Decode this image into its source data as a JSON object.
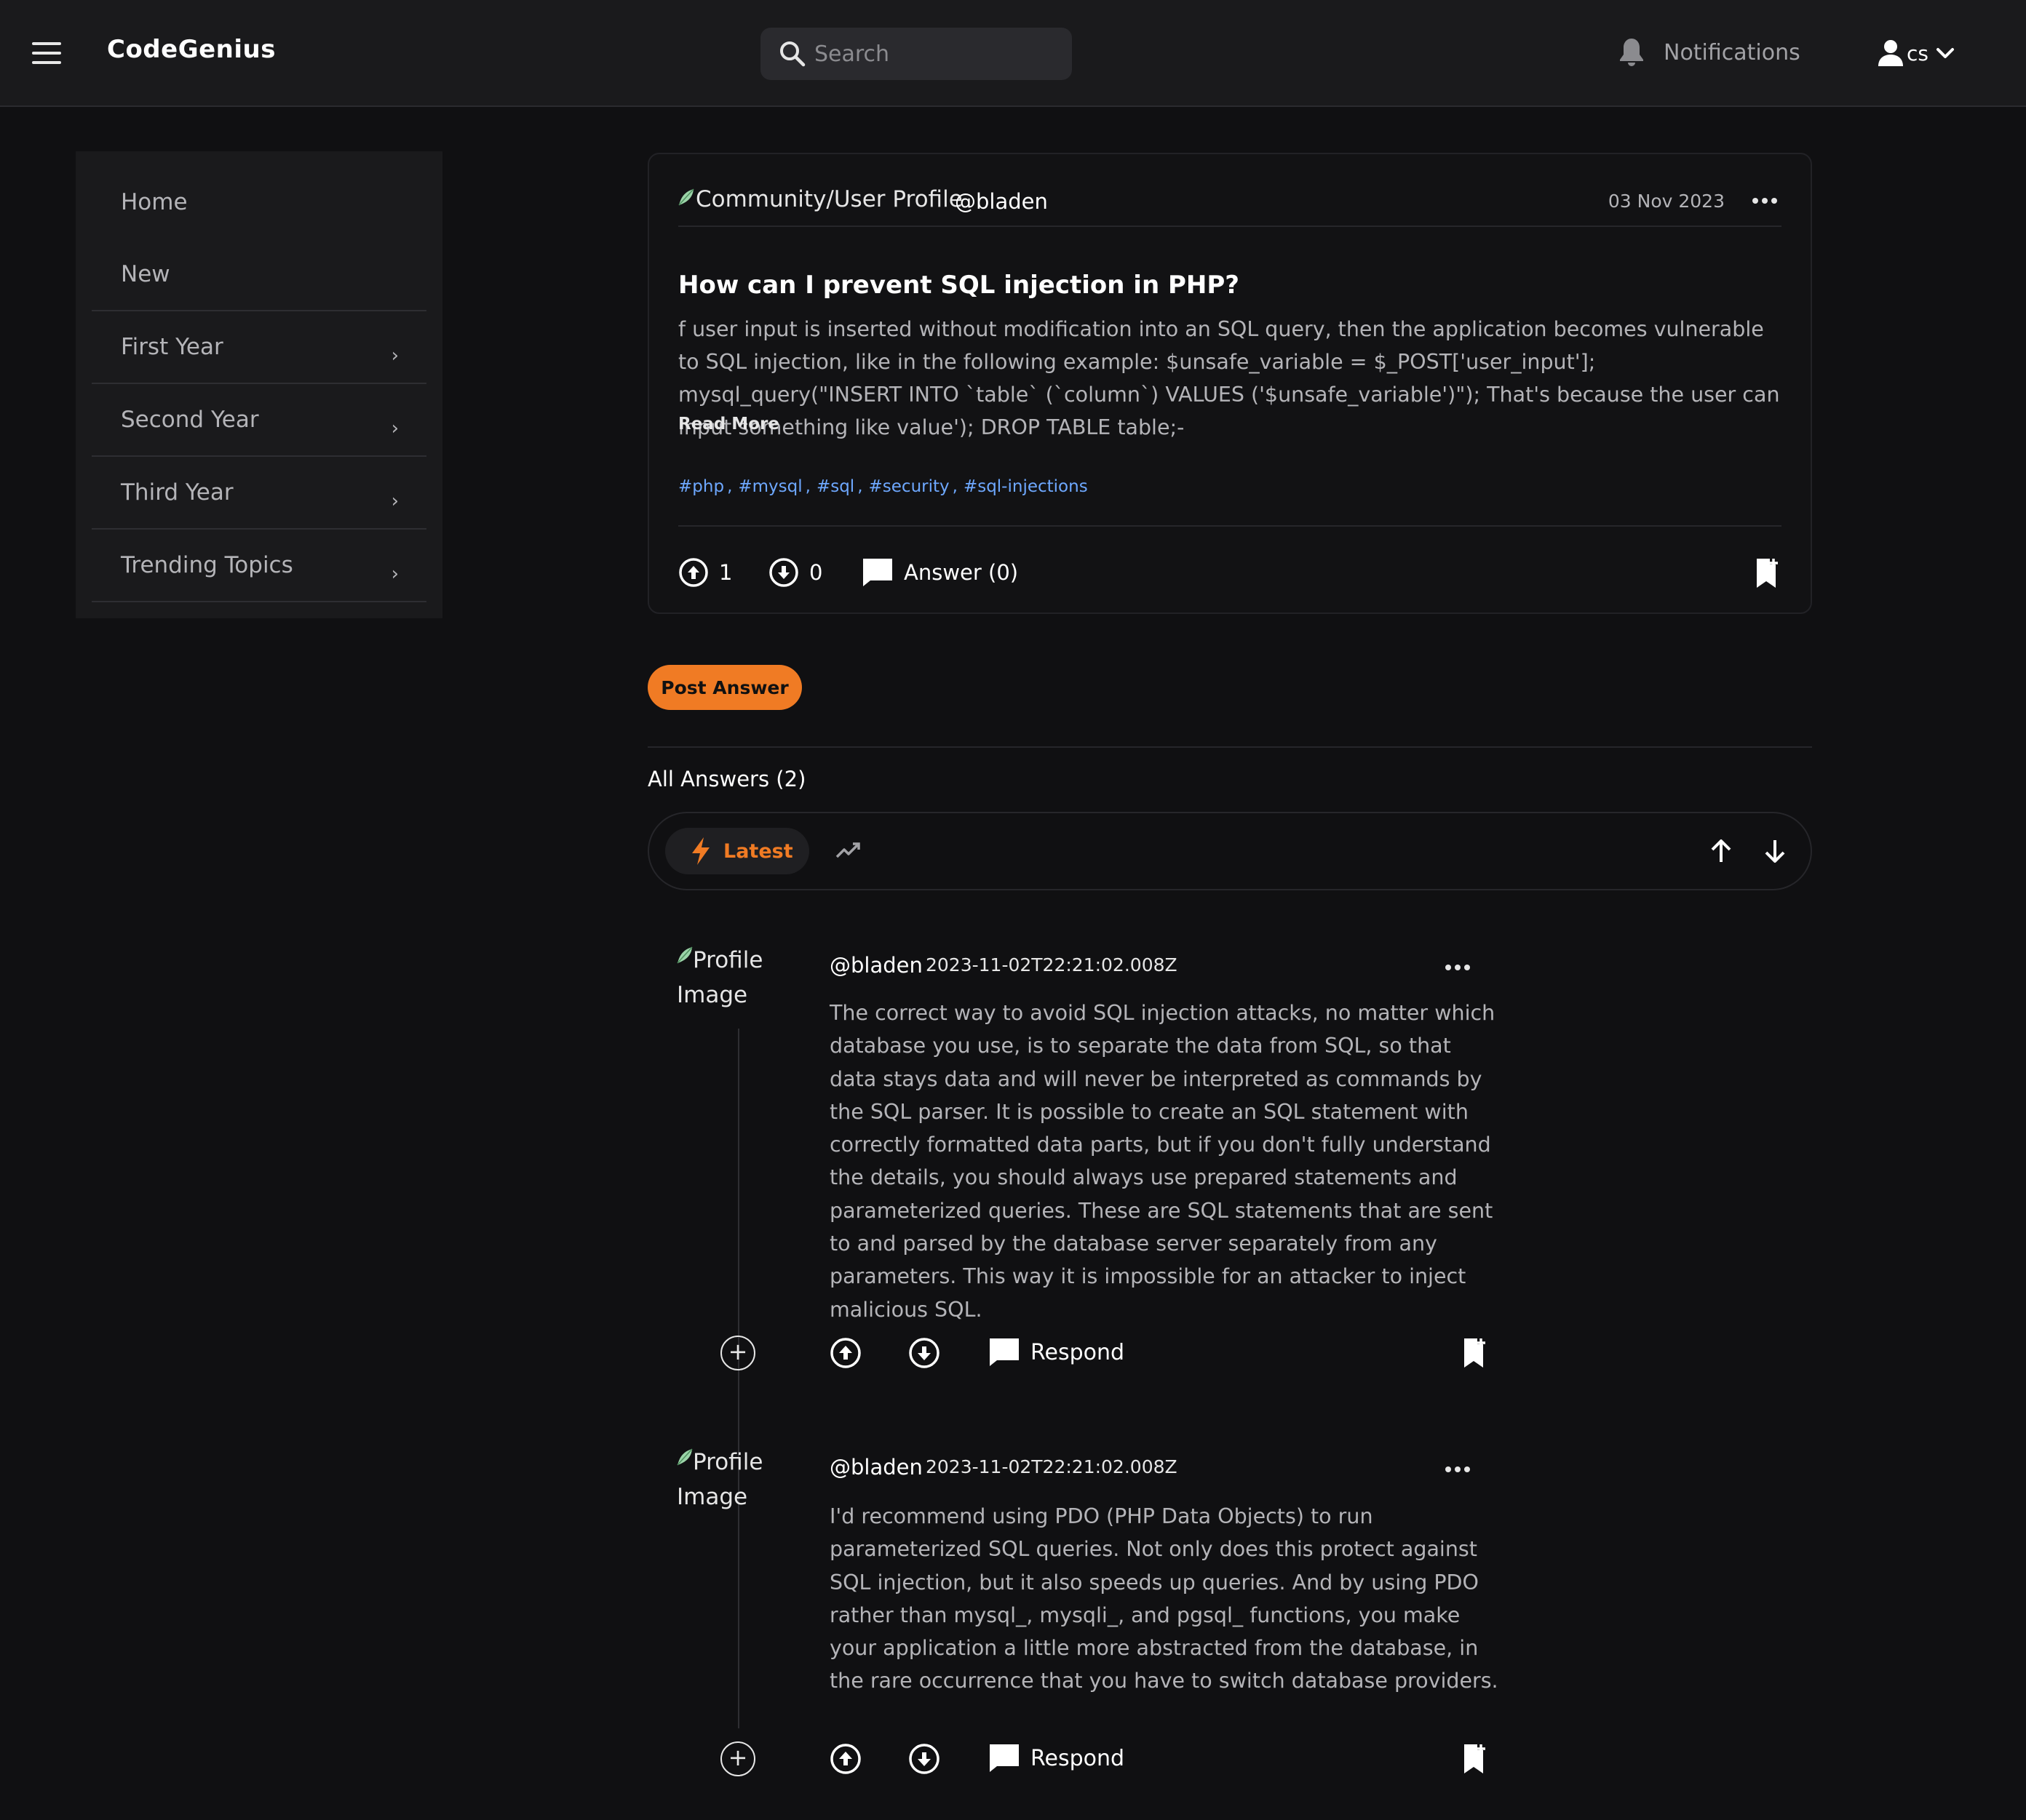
{
  "header": {
    "brand": "CodeGenius",
    "search_placeholder": "Search",
    "notifications_label": "Notifications",
    "user_name": "cs"
  },
  "sidebar": {
    "items": [
      {
        "label": "Home",
        "has_submenu": false
      },
      {
        "label": "New",
        "has_submenu": false
      },
      {
        "label": "First Year",
        "has_submenu": true
      },
      {
        "label": "Second Year",
        "has_submenu": true
      },
      {
        "label": "Third Year",
        "has_submenu": true
      },
      {
        "label": "Trending Topics",
        "has_submenu": true
      }
    ],
    "chevron": "›"
  },
  "question": {
    "author_img_alt": "Community/User Profile",
    "author_handle": "@bladen",
    "date": "03 Nov 2023",
    "title": "How can I prevent SQL injection in PHP?",
    "body": "f user input is inserted without modification into an SQL query, then the application becomes vulnerable to SQL injection, like in the following example: $unsafe_variable = $_POST['user_input']; mysql_query(\"INSERT INTO `table` (`column`) VALUES ('$unsafe_variable')\"); That's because the user can input something like value'); DROP TABLE table;-",
    "read_more": "Read More",
    "tags": [
      "#php",
      "#mysql",
      "#sql",
      "#security",
      "#sql-injections"
    ],
    "tag_separator": ",",
    "upvotes": "1",
    "downvotes": "0",
    "answer_label": "Answer (0)"
  },
  "post_answer_label": "Post Answer",
  "answers_section": {
    "heading": "All Answers (2)",
    "sort_latest_label": "Latest"
  },
  "answers": [
    {
      "img_alt": "Profile Image",
      "handle": "@bladen",
      "timestamp": "2023-11-02T22:21:02.008Z",
      "body": "The correct way to avoid SQL injection attacks, no matter which database you use, is to separate the data from SQL, so that data stays data and will never be interpreted as commands by the SQL parser. It is possible to create an SQL statement with correctly formatted data parts, but if you don't fully understand the details, you should always use prepared statements and parameterized queries. These are SQL statements that are sent to and parsed by the database server separately from any parameters. This way it is impossible for an attacker to inject malicious SQL.",
      "respond_label": "Respond"
    },
    {
      "img_alt": "Profile Image",
      "handle": "@bladen",
      "timestamp": "2023-11-02T22:21:02.008Z",
      "body": "I'd recommend using PDO (PHP Data Objects) to run parameterized SQL queries. Not only does this protect against SQL injection, but it also speeds up queries. And by using PDO rather than mysql_, mysqli_, and pgsql_ functions, you make your application a little more abstracted from the database, in the rare occurrence that you have to switch database providers.",
      "respond_label": "Respond"
    }
  ],
  "icons": {
    "menu": "hamburger-icon",
    "search": "search-icon",
    "notifications": "bell-icon",
    "user": "user-icon",
    "more": "ellipsis-icon",
    "upvote": "arrow-up-circle-icon",
    "downvote": "arrow-down-circle-icon",
    "comment": "comment-icon",
    "bookmark": "bookmark-add-icon",
    "latest": "lightning-icon",
    "trending": "trending-icon",
    "expand": "plus-circle-icon"
  },
  "colors": {
    "accent": "#f07b24",
    "tag": "#6ea8ff",
    "background": "#101012",
    "surface": "#1a1a1c"
  }
}
